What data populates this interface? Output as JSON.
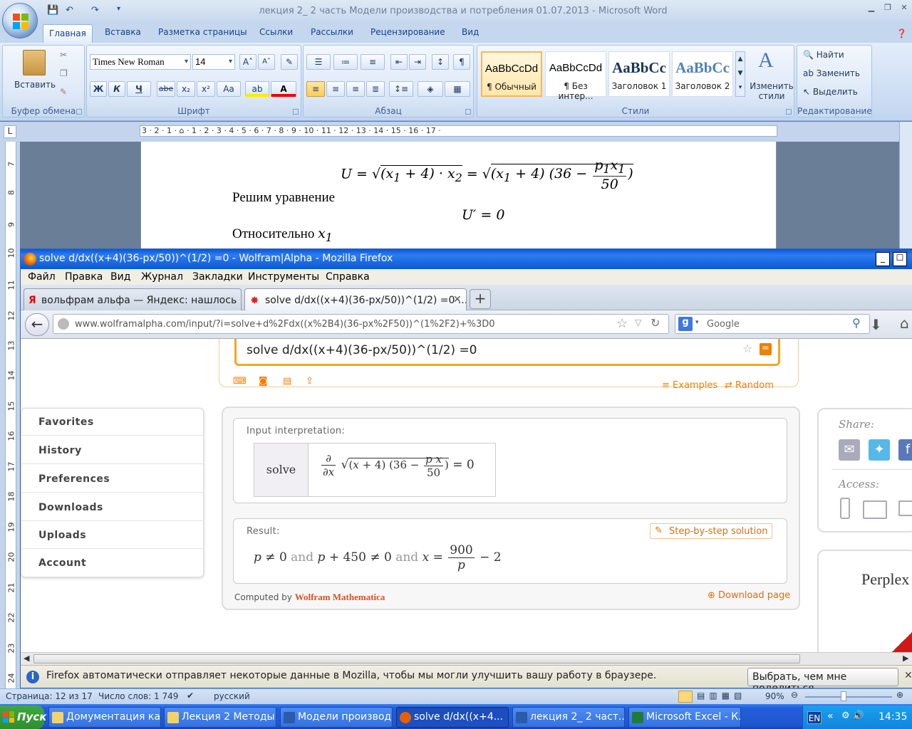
{
  "word": {
    "title": "лекция 2_ 2 часть Модели производства и потребления 01.07.2013 - Microsoft Word",
    "tabs": [
      "Главная",
      "Вставка",
      "Разметка страницы",
      "Ссылки",
      "Рассылки",
      "Рецензирование",
      "Вид"
    ],
    "clipboard": {
      "label": "Буфер обмена",
      "paste": "Вставить"
    },
    "font": {
      "label": "Шрифт",
      "name": "Times New Roman",
      "size": "14",
      "bold": "Ж",
      "italic": "К",
      "underline": "Ч",
      "strike": "abe",
      "sub": "x₂",
      "sup": "x²",
      "case": "Aa"
    },
    "paragraph": {
      "label": "Абзац"
    },
    "styles": {
      "label": "Стили",
      "items": [
        {
          "sample": "AaBbCcDd",
          "name": "¶ Обычный"
        },
        {
          "sample": "AaBbCcDd",
          "name": "¶ Без интер..."
        },
        {
          "sample": "AaBbCc",
          "name": "Заголовок 1"
        },
        {
          "sample": "AaBbCc",
          "name": "Заголовок 2"
        }
      ],
      "change": "Изменить стили"
    },
    "editing": {
      "label": "Редактирование",
      "find": "Найти",
      "replace": "Заменить",
      "select": "Выделить"
    },
    "ruler": "3 · 2 · 1 · ⌂ · 1 · 2 · 3 · 4 · 5 · 6 · 7 · 8 · 9 · 10 · 11 · 12 · 13 · 14 · 15 · 16 · 17 ·",
    "doc": {
      "line1": "Решим уравнение",
      "line2": "Относительно"
    },
    "status": {
      "page": "Страница: 12 из 17",
      "words": "Число слов: 1 749",
      "lang": "русский",
      "zoom": "90%"
    }
  },
  "firefox": {
    "title": "solve d/dx((x+4)(36-px/50))^(1/2) =0 - Wolfram|Alpha - Mozilla Firefox",
    "menu": [
      "Файл",
      "Правка",
      "Вид",
      "Журнал",
      "Закладки",
      "Инструменты",
      "Справка"
    ],
    "tabs": [
      {
        "label": "вольфрам альфа — Яндекс: нашлось ..."
      },
      {
        "label": "solve d/dx((x+4)(36-px/50))^(1/2) =0 ..."
      }
    ],
    "url": "www.wolframalpha.com/input/?i=solve+d%2Fdx((x%2B4)(36-px%2F50))^(1%2F2)+%3D0",
    "search_placeholder": "Google",
    "notification": "Firefox автоматически отправляет некоторые данные в Mozilla, чтобы мы могли улучшить вашу работу в браузере.",
    "notification_button": "Выбрать, чем мне поделиться"
  },
  "wolfram": {
    "query": "solve d/dx((x+4)(36-px/50))^(1/2) =0",
    "examples": "Examples",
    "random": "Random",
    "sidebar": [
      "Favorites",
      "History",
      "Preferences",
      "Downloads",
      "Uploads",
      "Account"
    ],
    "input_label": "Input interpretation:",
    "solve": "solve",
    "result_label": "Result:",
    "step": "Step-by-step solution",
    "and": "and",
    "computed_by": "Computed by",
    "mathematica": "Wolfram Mathematica",
    "download": "Download page",
    "share": "Share:",
    "access": "Access:",
    "ad": "Perplex a prob"
  },
  "taskbar": {
    "start": "Пуск",
    "items": [
      "Домументация ка...",
      "Лекция 2 Методы...",
      "Модели производ...",
      "solve d/dx((x+4...",
      "лекция 2_ 2 част...",
      "Microsoft Excel - К..."
    ],
    "lang": "EN",
    "time": "14:35"
  }
}
